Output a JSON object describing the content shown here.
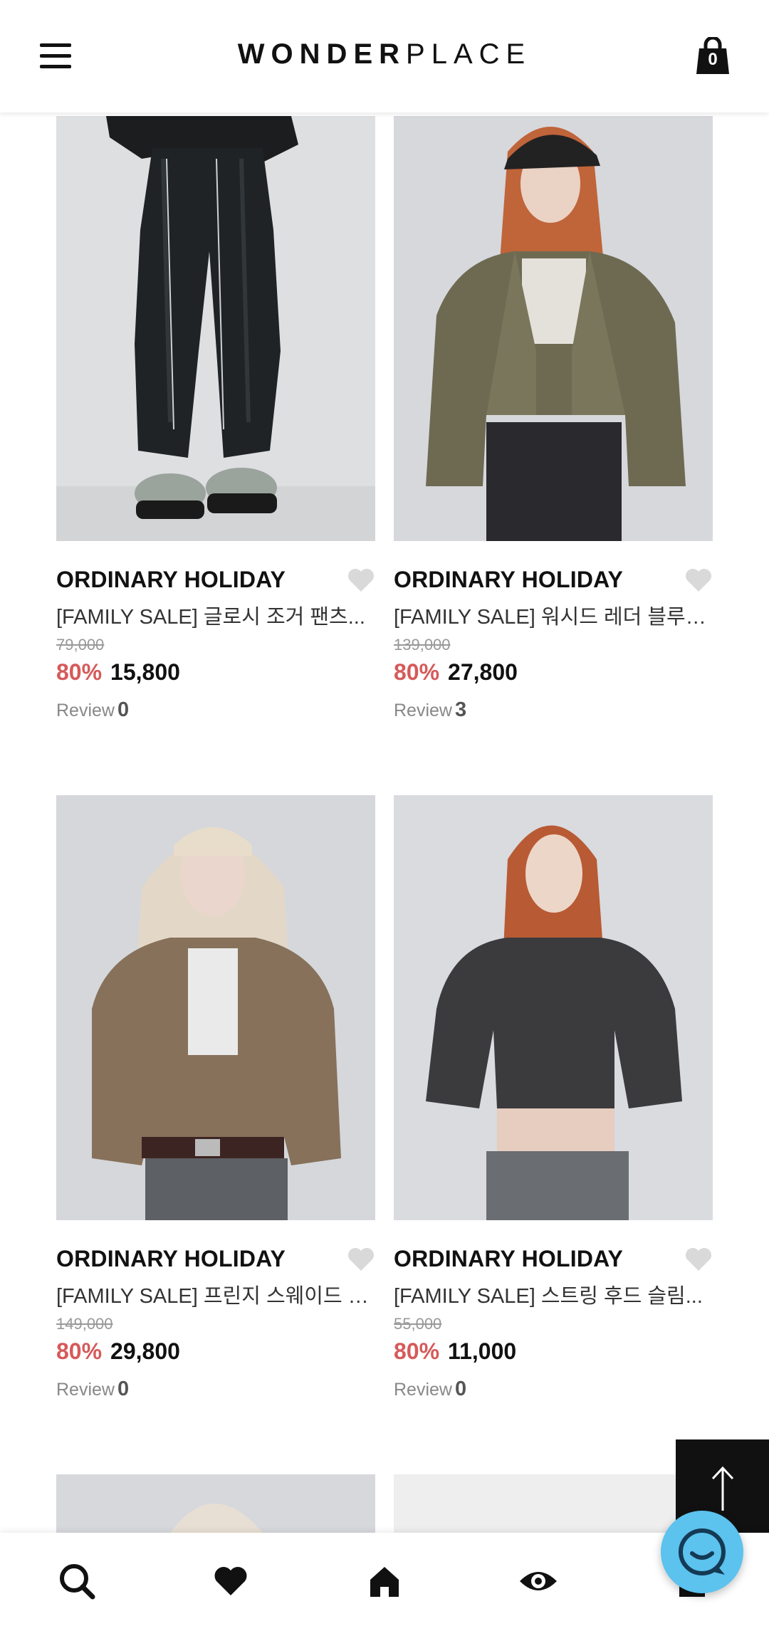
{
  "header": {
    "logo_bold": "WONDER",
    "logo_light": "PLACE",
    "cart_count": "0"
  },
  "products": [
    {
      "brand": "ORDINARY HOLIDAY",
      "title": "[FAMILY SALE] 글로시 조거 팬츠...",
      "original_price": "79,000",
      "discount": "80%",
      "price": "15,800",
      "review_label": "Review",
      "review_count": "0"
    },
    {
      "brand": "ORDINARY HOLIDAY",
      "title": "[FAMILY SALE] 워시드 레더 블루종...",
      "original_price": "139,000",
      "discount": "80%",
      "price": "27,800",
      "review_label": "Review",
      "review_count": "3"
    },
    {
      "brand": "ORDINARY HOLIDAY",
      "title": "[FAMILY SALE] 프린지 스웨이드 자...",
      "original_price": "149,000",
      "discount": "80%",
      "price": "29,800",
      "review_label": "Review",
      "review_count": "0"
    },
    {
      "brand": "ORDINARY HOLIDAY",
      "title": "[FAMILY SALE] 스트링 후드 슬림...",
      "original_price": "55,000",
      "discount": "80%",
      "price": "11,000",
      "review_label": "Review",
      "review_count": "0"
    }
  ],
  "icons": {
    "menu": "hamburger-menu-icon",
    "cart": "shopping-bag-icon",
    "wish": "heart-icon",
    "to_top": "arrow-up-icon",
    "nav": [
      "search-icon",
      "heart-icon",
      "home-icon",
      "eye-icon",
      "my-page-icon"
    ],
    "chat": "chat-icon"
  },
  "colors": {
    "discount": "#d65a5a",
    "chat": "#5cc2ee",
    "header_bg": "#ffffff",
    "to_top_bg": "#111111"
  }
}
